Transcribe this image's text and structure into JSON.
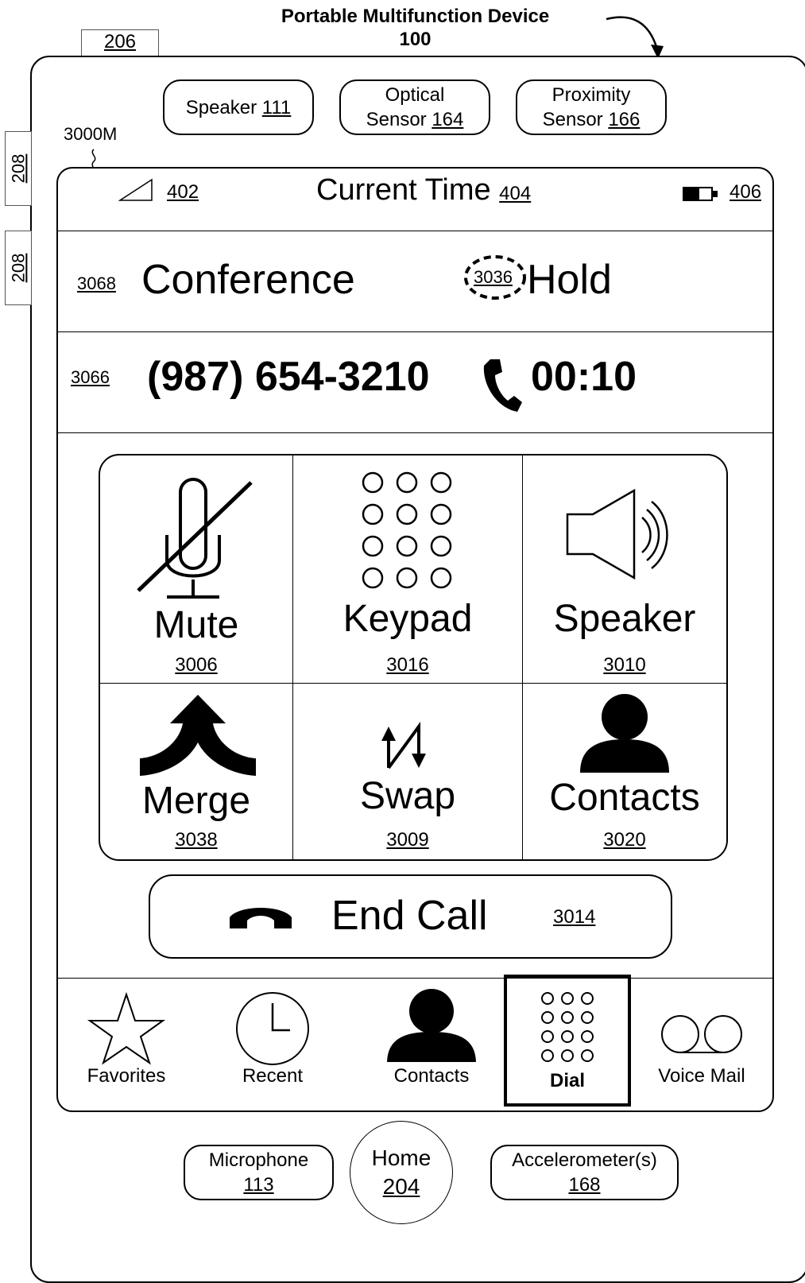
{
  "header": {
    "title_line1": "Portable Multifunction Device",
    "title_line2": "100",
    "ref_206": "206",
    "side_208_a": "208",
    "side_208_b": "208",
    "screen_ref": "3000M"
  },
  "hardware_top": {
    "speaker": {
      "text": "Speaker ",
      "num": "111"
    },
    "optical": {
      "line1": "Optical",
      "text": "Sensor ",
      "num": "164"
    },
    "proximity": {
      "line1": "Proximity",
      "text": "Sensor ",
      "num": "166"
    }
  },
  "status_bar": {
    "signal_ref": "402",
    "time_label": "Current Time ",
    "time_ref": "404",
    "battery_ref": "406"
  },
  "conference_row": {
    "ref": "3068",
    "label": "Conference",
    "hold_ref": "3036",
    "hold_label": "Hold"
  },
  "call_row": {
    "ref": "3066",
    "number": "(987) 654-3210",
    "duration": "00:10"
  },
  "controls": [
    {
      "label": "Mute",
      "ref": "3006",
      "icon": "mute-microphone-icon"
    },
    {
      "label": "Keypad",
      "ref": "3016",
      "icon": "keypad-icon"
    },
    {
      "label": "Speaker",
      "ref": "3010",
      "icon": "speaker-icon"
    },
    {
      "label": "Merge",
      "ref": "3038",
      "icon": "merge-arrow-icon"
    },
    {
      "label": "Swap",
      "ref": "3009",
      "icon": "swap-arrows-icon"
    },
    {
      "label": "Contacts",
      "ref": "3020",
      "icon": "contact-person-icon"
    }
  ],
  "end_call": {
    "label": "End Call",
    "ref": "3014",
    "icon": "hang-up-icon"
  },
  "tab_bar": [
    {
      "label": "Favorites",
      "icon": "star-icon",
      "selected": false
    },
    {
      "label": "Recent",
      "icon": "clock-icon",
      "selected": false
    },
    {
      "label": "Contacts",
      "icon": "person-icon",
      "selected": false
    },
    {
      "label": "Dial",
      "icon": "keypad-icon",
      "selected": true
    },
    {
      "label": "Voice Mail",
      "icon": "voicemail-icon",
      "selected": false
    }
  ],
  "hardware_bottom": {
    "microphone": {
      "label": "Microphone",
      "num": "113"
    },
    "home": {
      "label": "Home",
      "num": "204"
    },
    "accelerometer": {
      "label": "Accelerometer(s)",
      "num": "168"
    }
  }
}
